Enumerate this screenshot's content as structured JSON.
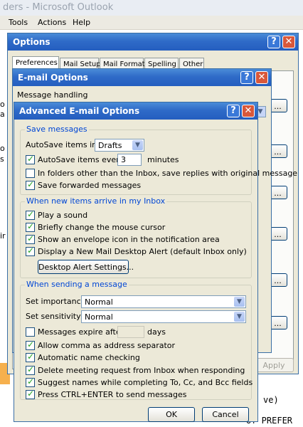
{
  "outlook": {
    "title": "ders - Microsoft Outlook",
    "menu": [
      "Tools",
      "Actions",
      "Help"
    ],
    "left_fragments": [
      "o",
      "a",
      "o",
      "s",
      "ir"
    ],
    "bottom_lines": [
      "ve)",
      "of PREFER"
    ]
  },
  "options_dialog": {
    "title": "Options",
    "tabs": [
      "Preferences",
      "Mail Setup",
      "Mail Format",
      "Spelling",
      "Other"
    ],
    "apply_label": "Apply",
    "side_button_label": "..."
  },
  "email_options": {
    "title": "E-mail Options",
    "section_label": "Message handling"
  },
  "advanced": {
    "title": "Advanced E-mail Options",
    "save_messages": {
      "legend": "Save messages",
      "autosave_in_label": "AutoSave items in:",
      "autosave_in_value": "Drafts",
      "autosave_every_label": "AutoSave items every:",
      "autosave_every_value": "3",
      "autosave_every_unit": "minutes",
      "other_folders_label": "In folders other than the Inbox, save replies with original message",
      "save_forwarded_label": "Save forwarded messages"
    },
    "new_items": {
      "legend": "When new items arrive in my Inbox",
      "play_sound": "Play a sound",
      "change_cursor": "Briefly change the mouse cursor",
      "envelope_icon": "Show an envelope icon in the notification area",
      "desktop_alert": "Display a New Mail Desktop Alert (default Inbox only)",
      "alert_settings_button": "Desktop Alert Settings..."
    },
    "sending": {
      "legend": "When sending a message",
      "importance_label": "Set importance:",
      "importance_value": "Normal",
      "sensitivity_label": "Set sensitivity:",
      "sensitivity_value": "Normal",
      "expire_label": "Messages expire after:",
      "expire_value": "",
      "expire_unit": "days",
      "comma_separator": "Allow comma as address separator",
      "auto_name_check": "Automatic name checking",
      "delete_meeting": "Delete meeting request from Inbox when responding",
      "suggest_names": "Suggest names while completing To, Cc, and Bcc fields",
      "ctrl_enter": "Press CTRL+ENTER to send messages"
    },
    "ok_label": "OK",
    "cancel_label": "Cancel"
  },
  "checks": {
    "autosave_every": true,
    "other_folders": false,
    "save_forwarded": true,
    "play_sound": true,
    "change_cursor": true,
    "envelope_icon": true,
    "desktop_alert": true,
    "expire": false,
    "comma_separator": true,
    "auto_name_check": true,
    "delete_meeting": true,
    "suggest_names": true,
    "ctrl_enter": true
  }
}
